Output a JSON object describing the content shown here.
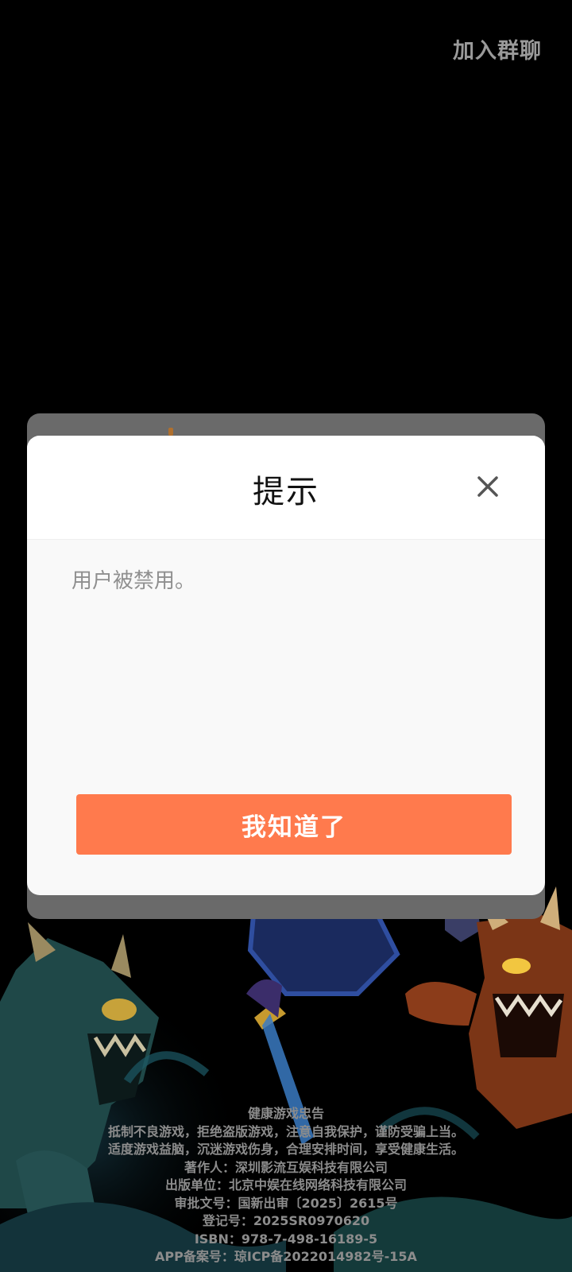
{
  "header": {
    "join_group_label": "加入群聊"
  },
  "dialog": {
    "title": "提示",
    "close_icon": "close-icon",
    "message": "用户被禁用。",
    "confirm_label": "我知道了"
  },
  "health_notice": {
    "title": "健康游戏忠告",
    "lines": [
      "抵制不良游戏，拒绝盗版游戏，注意自我保护，谨防受骗上当。",
      "适度游戏益脑，沉迷游戏伤身，合理安排时间，享受健康生活。",
      "著作人：深圳影流互娱科技有限公司",
      "出版单位：北京中娱在线网络科技有限公司",
      "审批文号：国新出审〔2025〕2615号",
      "登记号：2025SR0970620",
      "ISBN：978-7-498-16189-5",
      "APP备案号：琼ICP备2022014982号-15A"
    ]
  },
  "colors": {
    "accent": "#ff7a4d",
    "backdrop": "#000000",
    "dialog_bg": "#f9f9f9"
  }
}
